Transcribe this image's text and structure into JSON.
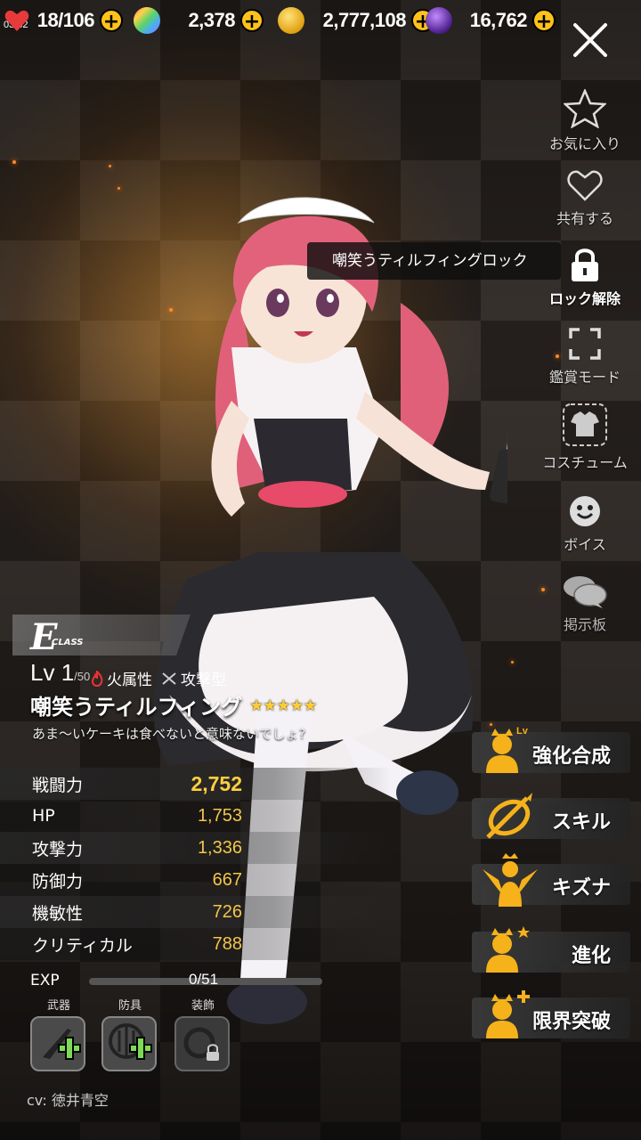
{
  "status": {
    "clock": "03:32"
  },
  "resources": [
    {
      "icon": "heart-icon",
      "value": "18/106"
    },
    {
      "icon": "gem-icon",
      "value": "2,378"
    },
    {
      "icon": "gold-coin-icon",
      "value": "2,777,108"
    },
    {
      "icon": "dark-crystal-icon",
      "value": "16,762"
    }
  ],
  "menu": {
    "favorite": "お気に入り",
    "share": "共有する",
    "unlock": "ロック解除",
    "view_mode": "鑑賞モード",
    "costume": "コスチューム",
    "voice": "ボイス",
    "board": "掲示板"
  },
  "lock_tooltip": "嘲笑うティルフィングロック",
  "character": {
    "class": "E",
    "class_label": "CLASS",
    "level_prefix": "Lv",
    "level": "1",
    "level_max": "/50",
    "element": "火属性",
    "type": "攻撃型",
    "name": "嘲笑うティルフィング",
    "stars": "★★★★★",
    "rarity": 5,
    "quote": "あま～いケーキは食べないと意味ないでしょ?",
    "cv": "cv: 徳井青空"
  },
  "stats": [
    {
      "label": "戦闘力",
      "value": "2,752"
    },
    {
      "label": "HP",
      "value": "1,753"
    },
    {
      "label": "攻撃力",
      "value": "1,336"
    },
    {
      "label": "防御力",
      "value": "667"
    },
    {
      "label": "機敏性",
      "value": "726"
    },
    {
      "label": "クリティカル",
      "value": "788"
    }
  ],
  "exp": {
    "label": "EXP",
    "value": "0/51",
    "progress": 0
  },
  "equipment": {
    "weapon": "武器",
    "armor": "防具",
    "accessory": "装飾"
  },
  "actions": {
    "enhance": "強化合成",
    "enhance_badge": "Lv",
    "skill": "スキル",
    "bond": "キズナ",
    "evolve": "進化",
    "limit_break": "限界突破"
  },
  "colors": {
    "accent": "#ffc21a",
    "stat_value": "#f2c64a"
  }
}
